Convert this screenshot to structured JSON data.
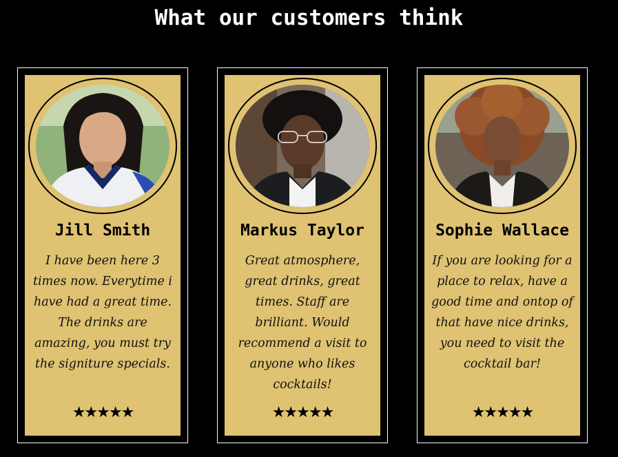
{
  "heading": "What our customers think",
  "colors": {
    "background": "#000000",
    "card": "#dfc272",
    "text": "#000000"
  },
  "reviews": [
    {
      "name": "Jill Smith",
      "text": "I have been here 3 times now. Everytime i have had a great time. The drinks are amazing, you must try the signiture specials.",
      "stars": "★★★★★",
      "rating": 5,
      "avatar": "woman-straight-black-hair-photo"
    },
    {
      "name": "Markus Taylor",
      "text": "Great atmosphere, great drinks, great times. Staff are brilliant. Would recommend a visit to anyone who likes cocktails!",
      "stars": "★★★★★",
      "rating": 5,
      "avatar": "man-glasses-photo"
    },
    {
      "name": "Sophie Wallace",
      "text": "If you are looking for a place to relax, have a good time and ontop of that have nice drinks, you need to visit the cocktail bar!",
      "stars": "★★★★★",
      "rating": 5,
      "avatar": "woman-curly-hair-photo"
    }
  ]
}
